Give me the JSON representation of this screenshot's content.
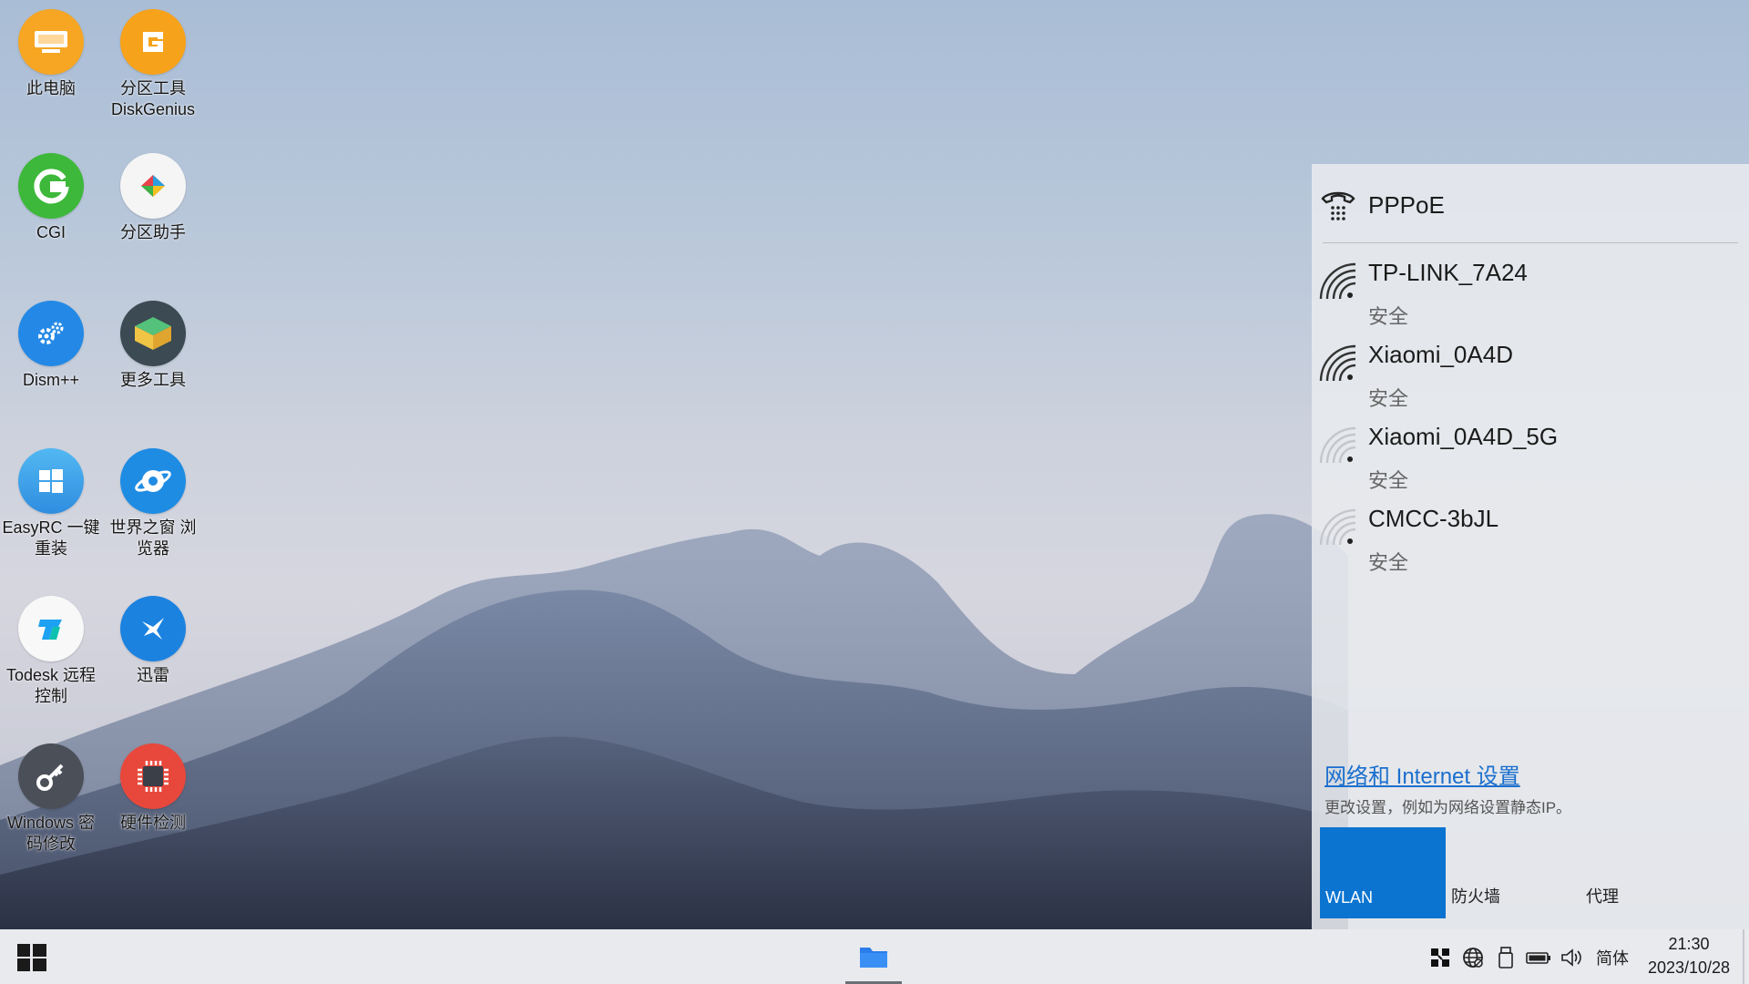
{
  "desktop": {
    "icons": [
      {
        "label": "此电脑",
        "icon": "computer-icon"
      },
      {
        "label": "分区工具DiskGenius",
        "icon": "diskgenius-icon"
      },
      {
        "label": "CGI",
        "icon": "cgi-icon"
      },
      {
        "label": "分区助手",
        "icon": "partition-assistant-icon"
      },
      {
        "label": "Dism++",
        "icon": "dism-icon"
      },
      {
        "label": "更多工具",
        "icon": "more-tools-icon"
      },
      {
        "label": "EasyRC 一键重装",
        "icon": "easyrc-icon"
      },
      {
        "label": "世界之窗 浏览器",
        "icon": "browser-icon"
      },
      {
        "label": "Todesk 远程控制",
        "icon": "todesk-icon"
      },
      {
        "label": "迅雷",
        "icon": "thunder-icon"
      },
      {
        "label": "Windows 密码修改",
        "icon": "key-icon"
      },
      {
        "label": "硬件检测",
        "icon": "chip-icon"
      }
    ]
  },
  "network_flyout": {
    "pppoe_label": "PPPoE",
    "networks": [
      {
        "name": "TP-LINK_7A24",
        "security": "安全"
      },
      {
        "name": "Xiaomi_0A4D",
        "security": "安全"
      },
      {
        "name": "Xiaomi_0A4D_5G",
        "security": "安全"
      },
      {
        "name": "CMCC-3bJL",
        "security": "安全"
      }
    ],
    "settings_link": "网络和 Internet 设置",
    "settings_desc": "更改设置，例如为网络设置静态IP。",
    "tiles": [
      {
        "label": "WLAN",
        "active": true
      },
      {
        "label": "防火墙",
        "active": false
      },
      {
        "label": "代理",
        "active": false
      }
    ]
  },
  "taskbar": {
    "ime": "简体",
    "time": "21:30",
    "date": "2023/10/28"
  },
  "colors": {
    "accent": "#0b74d0",
    "link": "#1a6fce"
  }
}
